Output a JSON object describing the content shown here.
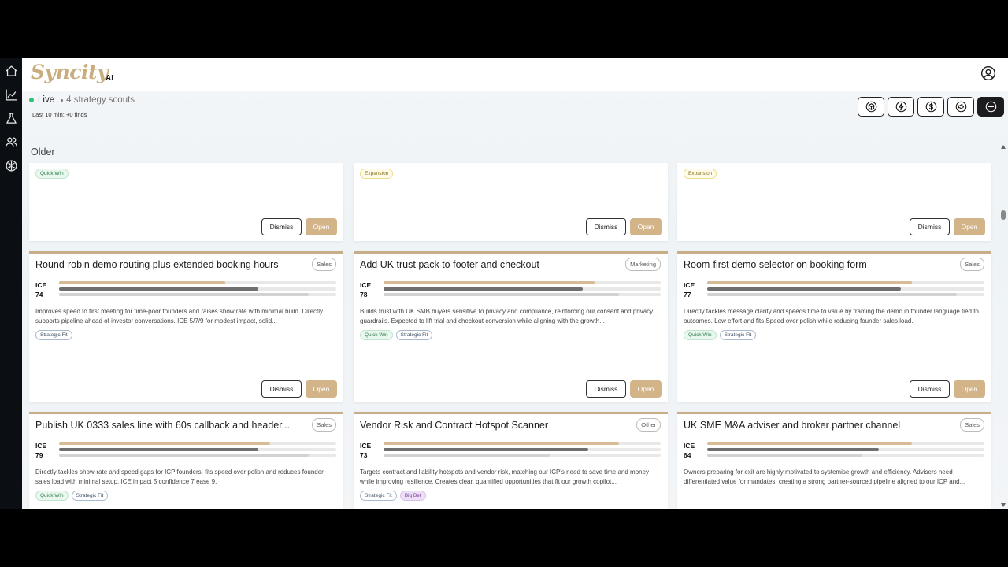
{
  "app": {
    "logo_text": "Syncity",
    "logo_suffix": "AI"
  },
  "status": {
    "live_label": "Live",
    "scouts_label": "4 strategy scouts",
    "last_period": "Last 10 min: +0 finds"
  },
  "toolbar": {
    "icons": [
      "cube-icon",
      "lightning-icon",
      "dollar-icon",
      "megaphone-icon",
      "plus-icon"
    ]
  },
  "section": {
    "title": "Older"
  },
  "actions": {
    "dismiss_label": "Dismiss",
    "open_label": "Open"
  },
  "partial_cards": [
    {
      "chip": "Quick Win"
    },
    {
      "chip": "Expansion"
    },
    {
      "chip": "Expansion"
    }
  ],
  "cards": [
    {
      "title": "Round-robin demo routing plus extended booking hours",
      "category": "Sales",
      "ice_label": "ICE",
      "ice": "74",
      "bars": [
        0.6,
        0.72,
        0.9
      ],
      "desc": "Improves speed to first meeting for time-poor founders and raises show rate with minimal build. Directly supports pipeline ahead of investor conversations. ICE 5/7/9 for modest impact, solid...",
      "tags": [
        {
          "label": "Strategic Fit",
          "style": "blue"
        }
      ]
    },
    {
      "title": "Add UK trust pack to footer and checkout",
      "category": "Marketing",
      "ice_label": "ICE",
      "ice": "78",
      "bars": [
        0.76,
        0.72,
        0.85
      ],
      "desc": "Builds trust with UK SMB buyers sensitive to privacy and compliance, reinforcing our consent and privacy guardrails. Expected to lift trial and checkout conversion while aligning with the growth...",
      "tags": [
        {
          "label": "Quick Win",
          "style": "green"
        },
        {
          "label": "Strategic Fit",
          "style": "blue"
        }
      ]
    },
    {
      "title": "Room-first demo selector on booking form",
      "category": "Sales",
      "ice_label": "ICE",
      "ice": "77",
      "bars": [
        0.74,
        0.7,
        0.9
      ],
      "desc": "Directly tackles message clarity and speeds time to value by framing the demo in founder language tied to outcomes. Low effort and fits Speed over polish while reducing founder sales load.",
      "tags": [
        {
          "label": "Quick Win",
          "style": "green"
        },
        {
          "label": "Strategic Fit",
          "style": "blue"
        }
      ]
    },
    {
      "title": "Publish UK 0333 sales line with 60s callback and header...",
      "category": "Sales",
      "ice_label": "ICE",
      "ice": "79",
      "bars": [
        0.76,
        0.72,
        0.9
      ],
      "desc": "Directly tackles show-rate and speed gaps for ICP founders, fits speed over polish and reduces founder sales load with minimal setup. ICE impact 5 confidence 7 ease 9.",
      "tags": [
        {
          "label": "Quick Win",
          "style": "green"
        },
        {
          "label": "Strategic Fit",
          "style": "blue"
        }
      ]
    },
    {
      "title": "Vendor Risk and Contract Hotspot Scanner",
      "category": "Other",
      "ice_label": "ICE",
      "ice": "73",
      "bars": [
        0.85,
        0.74,
        0.6
      ],
      "desc": "Targets contract and liability hotspots and vendor risk, matching our ICP's need to save time and money while improving resilience. Creates clear, quantified opportunities that fit our growth copilot...",
      "tags": [
        {
          "label": "Strategic Fit",
          "style": "blue"
        },
        {
          "label": "Big Bet",
          "style": "purple"
        }
      ]
    },
    {
      "title": "UK SME M&A adviser and broker partner channel",
      "category": "Sales",
      "ice_label": "ICE",
      "ice": "64",
      "bars": [
        0.74,
        0.62,
        0.56
      ],
      "desc": "Owners preparing for exit are highly motivated to systemise growth and efficiency. Advisers need differentiated value for mandates, creating a strong partner-sourced pipeline aligned to our ICP and...",
      "tags": []
    }
  ]
}
